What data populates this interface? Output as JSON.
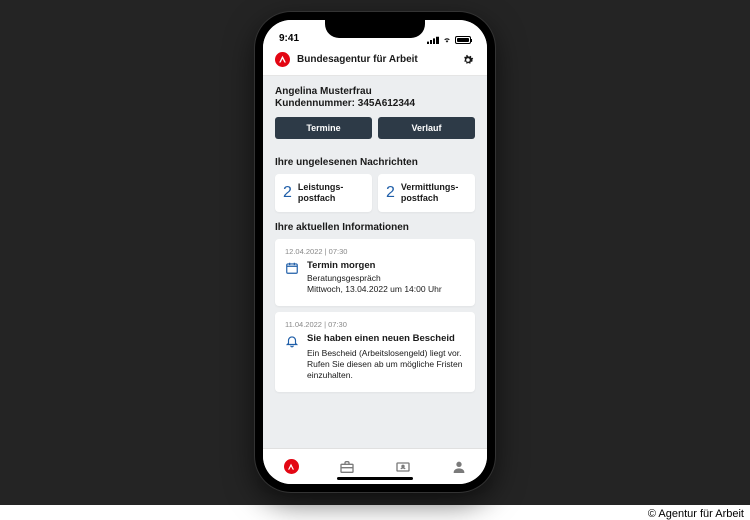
{
  "attribution": "© Agentur für Arbeit",
  "status": {
    "time": "9:41"
  },
  "header": {
    "title": "Bundesagentur für Arbeit"
  },
  "user": {
    "name": "Angelina Musterfrau",
    "customer_label": "Kundennummer:",
    "customer_number": "345A612344"
  },
  "buttons": {
    "termine": "Termine",
    "verlauf": "Verlauf"
  },
  "inbox": {
    "heading": "Ihre ungelesenen Nachrichten",
    "items": [
      {
        "count": "2",
        "label_l1": "Leistungs-",
        "label_l2": "postfach"
      },
      {
        "count": "2",
        "label_l1": "Vermittlungs-",
        "label_l2": "postfach"
      }
    ]
  },
  "info": {
    "heading": "Ihre aktuellen Informationen",
    "items": [
      {
        "timestamp": "12.04.2022 | 07:30",
        "title": "Termin morgen",
        "line1": "Beratungsgespräch",
        "line2": "Mittwoch, 13.04.2022 um 14:00 Uhr"
      },
      {
        "timestamp": "11.04.2022 | 07:30",
        "title": "Sie haben einen neuen Bescheid",
        "body": "Ein Bescheid (Arbeitslosengeld) liegt vor. Rufen Sie diesen ab um mögliche Fristen einzuhalten."
      }
    ]
  }
}
